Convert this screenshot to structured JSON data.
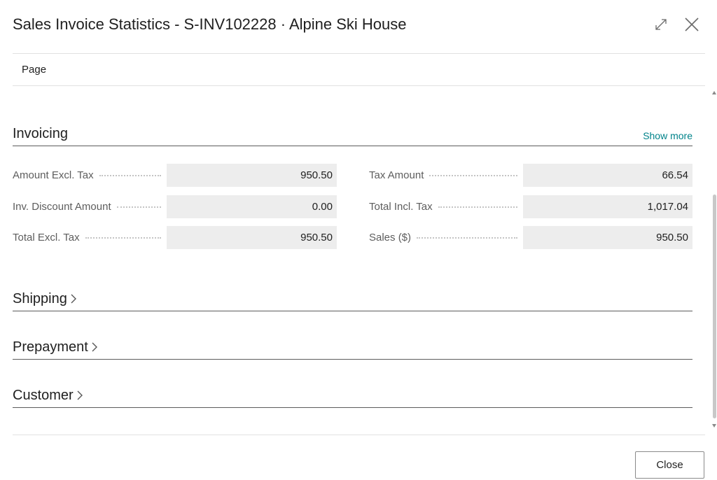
{
  "dialog": {
    "title": "Sales Invoice Statistics - S-INV102228 · Alpine Ski House",
    "expand_icon": "expand-diagonal-icon",
    "close_icon": "close-x-icon"
  },
  "menu": {
    "page_label": "Page"
  },
  "sections": {
    "invoicing": {
      "title": "Invoicing",
      "show_more": "Show more",
      "left_fields": [
        {
          "label": "Amount Excl. Tax",
          "value": "950.50"
        },
        {
          "label": "Inv. Discount Amount",
          "value": "0.00"
        },
        {
          "label": "Total Excl. Tax",
          "value": "950.50"
        }
      ],
      "right_fields": [
        {
          "label": "Tax Amount",
          "value": "66.54"
        },
        {
          "label": "Total Incl. Tax",
          "value": "1,017.04"
        },
        {
          "label": "Sales ($)",
          "value": "950.50"
        }
      ]
    },
    "shipping": {
      "title": "Shipping"
    },
    "prepayment": {
      "title": "Prepayment"
    },
    "customer": {
      "title": "Customer"
    }
  },
  "footer": {
    "close_label": "Close"
  },
  "colors": {
    "accent_link": "#00838a",
    "field_bg": "#ededed",
    "label_text": "#5d5d5d"
  }
}
